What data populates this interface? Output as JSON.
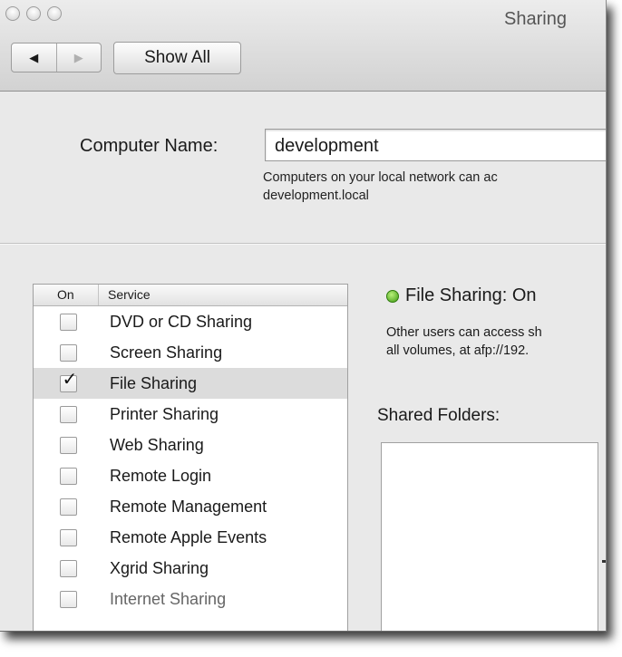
{
  "window": {
    "title": "Sharing"
  },
  "toolbar": {
    "back_glyph": "◀",
    "forward_glyph": "▶",
    "show_all_label": "Show All"
  },
  "computer_name": {
    "label": "Computer Name:",
    "value": "development",
    "help_line1": "Computers on your local network can ac",
    "help_line2": "development.local"
  },
  "services": {
    "header_on": "On",
    "header_service": "Service",
    "items": [
      {
        "label": "DVD or CD Sharing",
        "checked": false
      },
      {
        "label": "Screen Sharing",
        "checked": false
      },
      {
        "label": "File Sharing",
        "checked": true,
        "selected": true
      },
      {
        "label": "Printer Sharing",
        "checked": false
      },
      {
        "label": "Web Sharing",
        "checked": false
      },
      {
        "label": "Remote Login",
        "checked": false
      },
      {
        "label": "Remote Management",
        "checked": false
      },
      {
        "label": "Remote Apple Events",
        "checked": false
      },
      {
        "label": "Xgrid Sharing",
        "checked": false
      },
      {
        "label": "Internet Sharing",
        "checked": false,
        "disabled": true
      }
    ],
    "check_glyph": "✓"
  },
  "status": {
    "text": "File Sharing: On",
    "color": "#4caf1e",
    "desc_line1": "Other users can access sh",
    "desc_line2": "all volumes, at afp://192."
  },
  "shared_folders": {
    "label": "Shared Folders:"
  }
}
